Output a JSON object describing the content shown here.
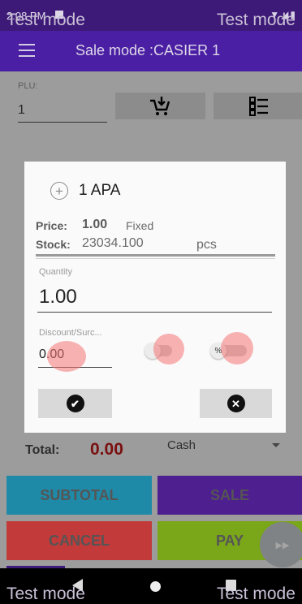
{
  "status": {
    "time": "2:08 PM",
    "icons": "▼◢▮"
  },
  "watermark": "Test mode",
  "appbar": {
    "title": "Sale mode :CASIER 1"
  },
  "plu": {
    "label": "PLU:",
    "value": "1"
  },
  "dialog": {
    "item_name": "1 APA",
    "price_label": "Price:",
    "price_value": "1.00",
    "price_type": "Fixed",
    "stock_label": "Stock:",
    "stock_value": "23034.100",
    "stock_unit": "pcs",
    "quantity_label": "Quantity",
    "quantity_value": "1.00",
    "discount_label": "Discount/Surc...",
    "discount_value": "0.00",
    "percent_symbol": "%"
  },
  "footer": {
    "total_label": "Total:",
    "total_value": "0.00",
    "payment_method": "Cash",
    "subtotal_label": "SUBTOTAL",
    "sale_label": "SALE",
    "cancel_label": "CANCEL",
    "pay_label": "PAY",
    "fab_glyph": "▶▶"
  },
  "colors": {
    "appbar": "#4a1fa3",
    "subtotal": "#1f8aa8",
    "sale": "#4e1f8f",
    "cancel": "#c23a3a",
    "pay": "#7aa61a",
    "total_value": "#7a0f10"
  }
}
